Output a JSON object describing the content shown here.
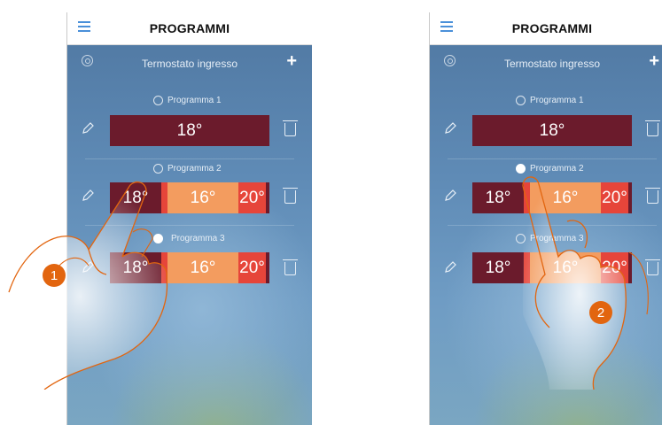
{
  "screens": [
    {
      "title": "PROGRAMMI",
      "thermostat": "Termostato ingresso",
      "step": "1",
      "programs": [
        {
          "name": "Programma 1",
          "selected": false,
          "segments": [
            {
              "label": "18°",
              "color": "#6b1b2c"
            }
          ]
        },
        {
          "name": "Programma 2",
          "selected": false,
          "segments": [
            {
              "label": "18°",
              "color": "#6b1b2c"
            },
            {
              "label": "16°",
              "color": "#f39c5f"
            },
            {
              "label": "20°",
              "color": "#e6453a"
            }
          ]
        },
        {
          "name": "Programma 3",
          "selected": true,
          "segments": [
            {
              "label": "18°",
              "color": "#6b1b2c"
            },
            {
              "label": "16°",
              "color": "#f39c5f"
            },
            {
              "label": "20°",
              "color": "#e6453a"
            }
          ]
        }
      ]
    },
    {
      "title": "PROGRAMMI",
      "thermostat": "Termostato ingresso",
      "step": "2",
      "programs": [
        {
          "name": "Programma 1",
          "selected": false,
          "segments": [
            {
              "label": "18°",
              "color": "#6b1b2c"
            }
          ]
        },
        {
          "name": "Programma 2",
          "selected": true,
          "segments": [
            {
              "label": "18°",
              "color": "#6b1b2c"
            },
            {
              "label": "16°",
              "color": "#f39c5f"
            },
            {
              "label": "20°",
              "color": "#e6453a"
            }
          ]
        },
        {
          "name": "Programma 3",
          "selected": false,
          "segments": [
            {
              "label": "18°",
              "color": "#6b1b2c"
            },
            {
              "label": "16°",
              "color": "#f39c5f"
            },
            {
              "label": "20°",
              "color": "#e6453a"
            }
          ]
        }
      ]
    }
  ],
  "icons": {
    "menu": "hamburger-menu-icon",
    "settings": "gear-icon",
    "add": "plus-icon",
    "edit": "pencil-icon",
    "delete": "trash-icon"
  },
  "colors": {
    "accent": "#4a90d9",
    "step_badge": "#e2650f"
  }
}
